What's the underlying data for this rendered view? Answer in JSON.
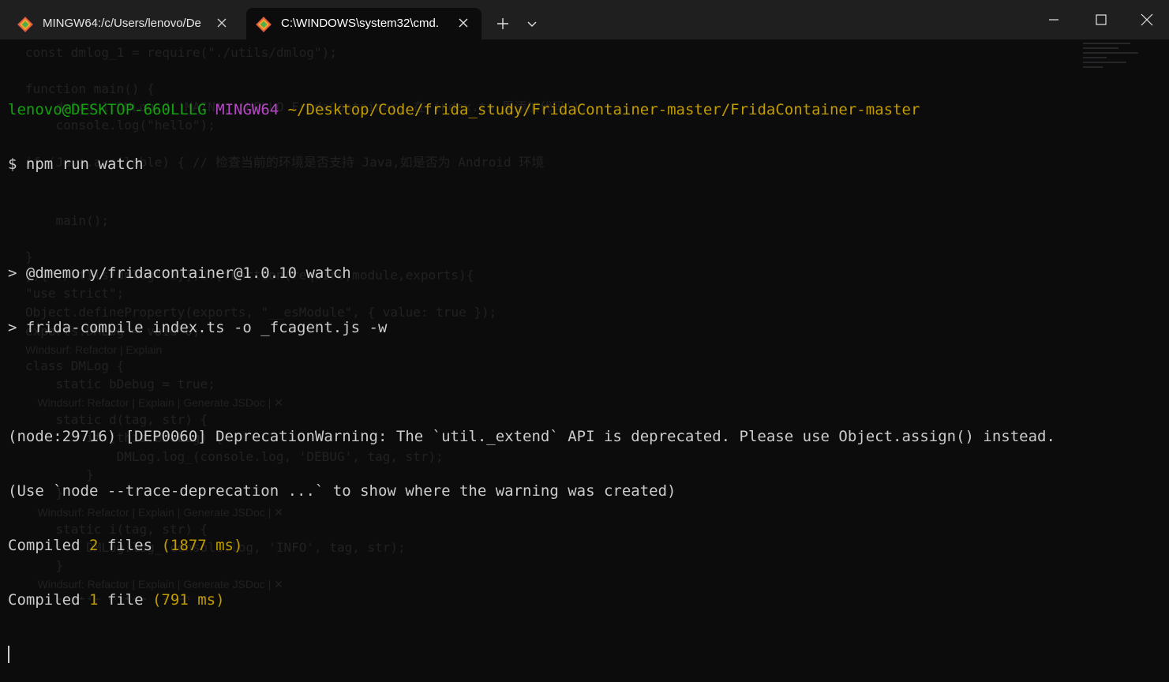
{
  "tabs": [
    {
      "title": "MINGW64:/c/Users/lenovo/De",
      "icon": "git-bash-icon",
      "active": false
    },
    {
      "title": "C:\\WINDOWS\\system32\\cmd.",
      "icon": "git-bash-icon",
      "active": true
    }
  ],
  "window_controls": [
    "minimize-icon",
    "maximize-icon",
    "close-icon"
  ],
  "colors": {
    "background": "#0c0c0c",
    "titlebar": "#1f1f1f",
    "text": "#cccccc",
    "user_host": "#13a10e",
    "shell": "#b847c8",
    "path": "#c19c00",
    "numbers": "#c19c00"
  },
  "terminal": {
    "prompt_user_host": "lenovo@DESKTOP-660LLLG",
    "prompt_shell": "MINGW64",
    "prompt_path": "~/Desktop/Code/frida_study/FridaContainer-master/FridaContainer-master",
    "command": "$ npm run watch",
    "npm_line1": "> @dmemory/fridacontainer@1.0.10 watch",
    "npm_line2": "> frida-compile index.ts -o _fcagent.js -w",
    "warning_line1": "(node:29716) [DEP0060] DeprecationWarning: The `util._extend` API is deprecated. Please use Object.assign() instead.",
    "warning_line2": "(Use `node --trace-deprecation ...` to show where the warning was created)",
    "compile1": {
      "prefix": "Compiled ",
      "count": "2",
      "word": " files ",
      "time": "(1877 ms)"
    },
    "compile2": {
      "prefix": "Compiled ",
      "count": "1",
      "word": " file ",
      "time": "(791 ms)"
    }
  },
  "background_editor": {
    "lines": [
      "const dmlog_1 = require(\"./utils/dmlog\");",
      "function main() {",
      "    dmlog_1.DMLog.d('MAIN', 'HELLO FridaContainer, 在 index.ts 里添加代码');",
      "    console.log(\"hello\");",
      "if (Java.available) { // 检查当前的环境是否支持 Java,如是否为 Android 环境",
      "    main();",
      "}",
      "},{\"./utils/dmlog\":2}],2:[function(require,module,exports){",
      "\"use strict\";",
      "Object.defineProperty(exports, \"__esModule\", { value: true });",
      "exports.DMLog = void 0;",
      "Windsurf: Refactor | Explain",
      "class DMLog {",
      "    static bDebug = true;",
      "    Windsurf: Refactor | Explain | Generate JSDoc | ✕",
      "    static d(tag, str) {",
      "        if (this.bDebug) {",
      "            DMLog.log_(console.log, 'DEBUG', tag, str);",
      "        }",
      "    }",
      "    Windsurf: Refactor | Explain | Generate JSDoc | ✕",
      "    static i(tag, str) {",
      "        DMLog.log_(console.log, 'INFO', tag, str);",
      "    }",
      "    Windsurf: Refactor | Explain | Generate JSDoc | ✕",
      "    static w(tag, str) {"
    ]
  }
}
